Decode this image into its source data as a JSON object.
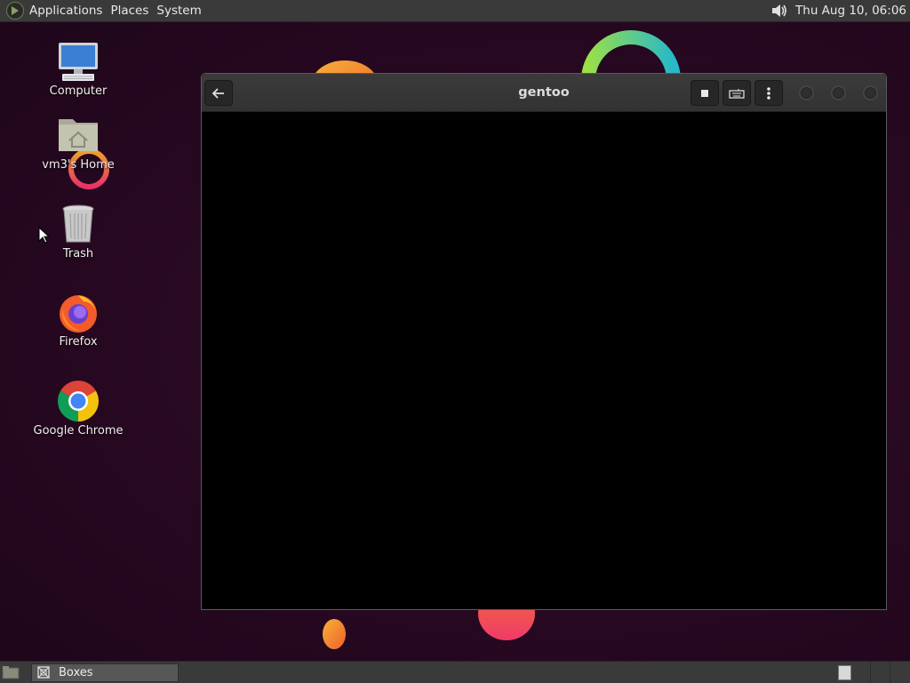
{
  "top_panel": {
    "menus": [
      "Applications",
      "Places",
      "System"
    ],
    "clock": "Thu Aug 10, 06:06",
    "speaker_icon": "speaker-icon"
  },
  "desktop": {
    "icons": [
      {
        "label": "Computer",
        "icon": "computer-icon"
      },
      {
        "label": "vm3's Home",
        "icon": "home-folder-icon"
      },
      {
        "label": "Trash",
        "icon": "trash-icon"
      },
      {
        "label": "Firefox",
        "icon": "firefox-icon"
      },
      {
        "label": "Google Chrome",
        "icon": "chrome-icon"
      }
    ]
  },
  "window": {
    "title": "gentoo",
    "back_icon": "back-arrow-icon",
    "toolbar_icons": [
      "stop-icon",
      "keyboard-icon",
      "menu-kebab-icon"
    ]
  },
  "taskbar": {
    "tasks": [
      {
        "label": "Boxes",
        "icon": "boxes-icon"
      }
    ]
  },
  "colors": {
    "panel": "#3a3a3a",
    "wallpaper": "#2a0b22",
    "window_body": "#000000"
  }
}
